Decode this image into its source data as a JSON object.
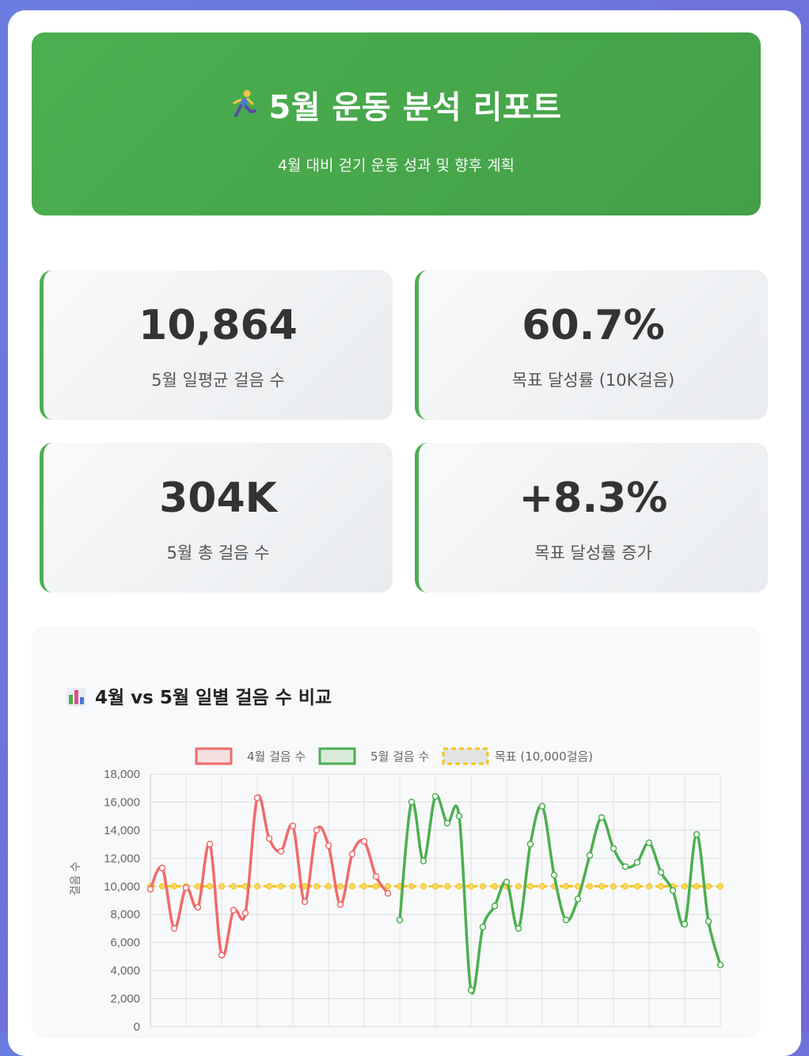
{
  "hero": {
    "title": "5월 운동 분석 리포트",
    "subtitle": "4월 대비 걷기 운동 성과 및 향후 계획",
    "icon": "running-person-icon"
  },
  "stats": [
    {
      "value": "10,864",
      "label": "5월 일평균 걸음 수"
    },
    {
      "value": "60.7%",
      "label": "목표 달성률 (10K걸음)"
    },
    {
      "value": "304K",
      "label": "5월 총 걸음 수"
    },
    {
      "value": "+8.3%",
      "label": "목표 달성률 증가"
    }
  ],
  "chart": {
    "title": "4월 vs 5월 일별 걸음 수 비교",
    "icon": "bar-chart-icon"
  },
  "chart_data": {
    "type": "line",
    "ylabel": "걸음 수",
    "ylim": [
      0,
      18000
    ],
    "yticks": [
      "0",
      "2,000",
      "4,000",
      "6,000",
      "8,000",
      "10,000",
      "12,000",
      "14,000",
      "16,000",
      "18,000"
    ],
    "grid": true,
    "legend_position": "top",
    "series": [
      {
        "name": "4월 걸음 수",
        "color": "#f06b6b",
        "start_index": 0,
        "values": [
          9800,
          11300,
          7000,
          9900,
          8500,
          13000,
          5100,
          8300,
          8100,
          16300,
          13400,
          12500,
          14300,
          8900,
          14000,
          12900,
          8700,
          12300,
          13200,
          10700,
          9500
        ]
      },
      {
        "name": "5월 걸음 수",
        "color": "#4caf50",
        "start_index": 21,
        "values": [
          7600,
          16000,
          11800,
          16400,
          14500,
          15000,
          2600,
          7100,
          8600,
          10300,
          7000,
          13000,
          15700,
          10800,
          7600,
          9100,
          12200,
          14900,
          12700,
          11400,
          11700,
          13100,
          11000,
          9700,
          7300,
          13700,
          7500,
          4400
        ]
      },
      {
        "name": "목표 (10,000걸음)",
        "color": "#f5c518",
        "dashed": true,
        "start_index": 0,
        "values": [
          10000,
          10000,
          10000,
          10000,
          10000,
          10000,
          10000,
          10000,
          10000,
          10000,
          10000,
          10000,
          10000,
          10000,
          10000,
          10000,
          10000,
          10000,
          10000,
          10000,
          10000,
          10000,
          10000,
          10000,
          10000,
          10000,
          10000,
          10000,
          10000,
          10000,
          10000,
          10000,
          10000,
          10000,
          10000,
          10000,
          10000,
          10000,
          10000,
          10000,
          10000,
          10000,
          10000,
          10000,
          10000,
          10000,
          10000,
          10000,
          10000
        ]
      }
    ]
  }
}
